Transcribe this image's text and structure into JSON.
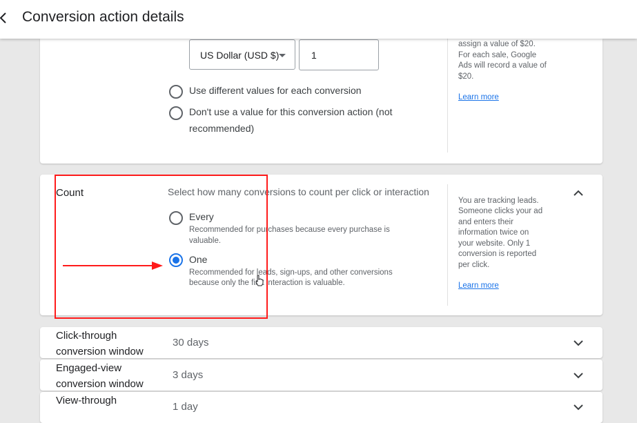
{
  "header": {
    "title": "Conversion action details",
    "back_icon": "chevron-left-icon"
  },
  "value_section": {
    "currency_select": "US Dollar (USD $)",
    "value_input": "1",
    "options": [
      {
        "label": "Use different values for each conversion",
        "checked": false
      },
      {
        "label_line1": "Don't use a value for this conversion action (not",
        "label_line2": "recommended)",
        "checked": false
      }
    ],
    "side_text": [
      "assign a value of $20.",
      "For each sale, Google",
      "Ads will record a value of",
      "$20."
    ],
    "learn_more": "Learn more"
  },
  "count_section": {
    "title": "Count",
    "prompt": "Select how many conversions to count per click or interaction",
    "options": [
      {
        "label": "Every",
        "desc_line1": "Recommended for purchases because every purchase is",
        "desc_line2": "valuable.",
        "checked": false
      },
      {
        "label": "One",
        "desc_line1": "Recommended for leads, sign-ups, and other conversions",
        "desc_line2": "because only the first interaction is valuable.",
        "checked": true
      }
    ],
    "side_text": [
      "You are tracking leads.",
      "Someone clicks your ad",
      "and enters their",
      "information twice on",
      "your website. Only 1",
      "conversion is reported",
      "per click."
    ],
    "learn_more": "Learn more",
    "expanded": true
  },
  "rows": [
    {
      "label_line1": "Click-through",
      "label_line2": "conversion window",
      "value": "30 days"
    },
    {
      "label_line1": "Engaged-view",
      "label_line2": "conversion window",
      "value": "3 days"
    },
    {
      "label_line1": "View-through",
      "label_line2": "",
      "value": "1 day"
    }
  ],
  "colors": {
    "accent": "#1a73e8",
    "annotation": "#ff1a1a",
    "background": "#e8e8e8"
  }
}
